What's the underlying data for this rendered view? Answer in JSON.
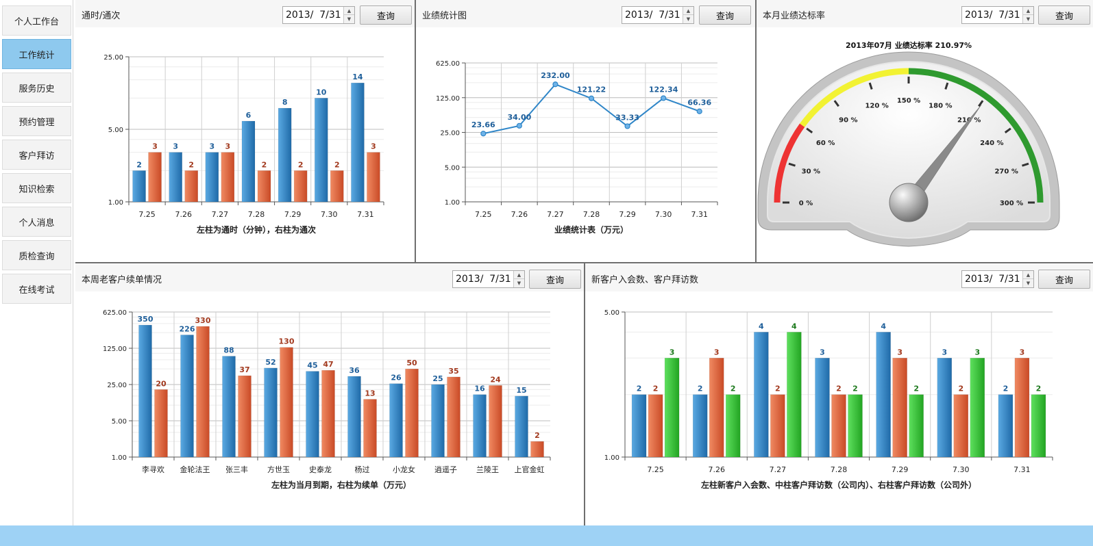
{
  "sidebar": {
    "items": [
      {
        "label": "个人工作台",
        "name": "sidebar-item-workbench"
      },
      {
        "label": "工作统计",
        "name": "sidebar-item-work-stats",
        "active": true
      },
      {
        "label": "服务历史",
        "name": "sidebar-item-service-history"
      },
      {
        "label": "预约管理",
        "name": "sidebar-item-appointments"
      },
      {
        "label": "客户拜访",
        "name": "sidebar-item-customer-visits"
      },
      {
        "label": "知识检索",
        "name": "sidebar-item-knowledge-search"
      },
      {
        "label": "个人消息",
        "name": "sidebar-item-messages"
      },
      {
        "label": "质检查询",
        "name": "sidebar-item-qc-query"
      },
      {
        "label": "在线考试",
        "name": "sidebar-item-online-exam"
      }
    ]
  },
  "common": {
    "date_value": "2013/  7/31",
    "query_label": "查询",
    "spin_up": "▲",
    "spin_down": "▼"
  },
  "panels": {
    "calls": {
      "title": "通时/通次"
    },
    "performance": {
      "title": "业绩统计图"
    },
    "rate": {
      "title": "本月业绩达标率"
    },
    "renewals": {
      "title": "本周老客户续单情况"
    },
    "newcustomers": {
      "title": "新客户入会数、客户拜访数"
    }
  },
  "colors": {
    "blue": "#2e7fc0",
    "orange": "#e0603a",
    "green": "#38c138",
    "line": "#2f86c8",
    "label_blue": "#1f5f9a",
    "label_orange": "#a2391e",
    "label_green": "#1e7a1e",
    "gauge_red": "#ee3333",
    "gauge_yellow": "#f2f233",
    "gauge_green": "#2f9a2f"
  },
  "chart_data": [
    {
      "id": "calls",
      "type": "bar",
      "scale": "log",
      "categories": [
        "7.25",
        "7.26",
        "7.27",
        "7.28",
        "7.29",
        "7.30",
        "7.31"
      ],
      "series": [
        {
          "values": [
            2,
            3,
            3,
            6,
            8,
            10,
            14
          ]
        },
        {
          "values": [
            3,
            2,
            3,
            2,
            2,
            2,
            3
          ]
        }
      ],
      "ylim": [
        1,
        25
      ],
      "yticks": [
        "1.00",
        "5.00",
        "25.00"
      ],
      "xlabel": "左柱为通时（分钟），右柱为通次",
      "grid": true
    },
    {
      "id": "performance",
      "type": "line",
      "scale": "log",
      "categories": [
        "7.25",
        "7.26",
        "7.27",
        "7.28",
        "7.29",
        "7.30",
        "7.31"
      ],
      "values": [
        23.66,
        34.0,
        232.0,
        121.22,
        33.33,
        122.34,
        66.36
      ],
      "labels": [
        "23.66",
        "34.00",
        "232.00",
        "121.22",
        "33.33",
        "122.34",
        "66.36"
      ],
      "ylim": [
        1,
        625
      ],
      "yticks": [
        "1.00",
        "5.00",
        "25.00",
        "125.00",
        "625.00"
      ],
      "xlabel": "业绩统计表（万元）",
      "grid": true
    },
    {
      "id": "rate",
      "type": "gauge",
      "title": "2013年07月 业绩达标率 210.97%",
      "value": 210.97,
      "range": [
        0,
        300
      ],
      "ticks": [
        "0 %",
        "30 %",
        "60 %",
        "90 %",
        "120 %",
        "150 %",
        "180 %",
        "210 %",
        "240 %",
        "270 %",
        "300 %"
      ],
      "bands": [
        {
          "from": 0,
          "to": 60,
          "color": "red"
        },
        {
          "from": 60,
          "to": 150,
          "color": "yellow"
        },
        {
          "from": 150,
          "to": 300,
          "color": "green"
        }
      ]
    },
    {
      "id": "renewals",
      "type": "bar",
      "scale": "log",
      "categories": [
        "李寻欢",
        "金轮法王",
        "张三丰",
        "方世玉",
        "史泰龙",
        "杨过",
        "小龙女",
        "逍遥子",
        "兰陵王",
        "上官金虹"
      ],
      "series": [
        {
          "values": [
            350,
            226,
            88,
            52,
            45,
            36,
            26,
            25,
            16,
            15
          ]
        },
        {
          "values": [
            20,
            330,
            37,
            130,
            47,
            13,
            50,
            35,
            24,
            2
          ]
        }
      ],
      "ylim": [
        1,
        625
      ],
      "yticks": [
        "1.00",
        "5.00",
        "25.00",
        "125.00",
        "625.00"
      ],
      "xlabel": "左柱为当月到期，右柱为续单（万元）",
      "grid": true
    },
    {
      "id": "newcustomers",
      "type": "bar",
      "scale": "log",
      "categories": [
        "7.25",
        "7.26",
        "7.27",
        "7.28",
        "7.29",
        "7.30",
        "7.31"
      ],
      "series": [
        {
          "values": [
            2,
            2,
            4,
            3,
            4,
            3,
            2
          ]
        },
        {
          "values": [
            2,
            3,
            2,
            2,
            3,
            2,
            3
          ]
        },
        {
          "values": [
            3,
            2,
            4,
            2,
            2,
            3,
            2
          ]
        }
      ],
      "ylim": [
        1,
        5
      ],
      "yticks": [
        "1.00",
        "5.00"
      ],
      "xlabel": "左柱新客户入会数、中柱客户拜访数（公司内）、右柱客户拜访数（公司外）",
      "grid": true
    }
  ]
}
